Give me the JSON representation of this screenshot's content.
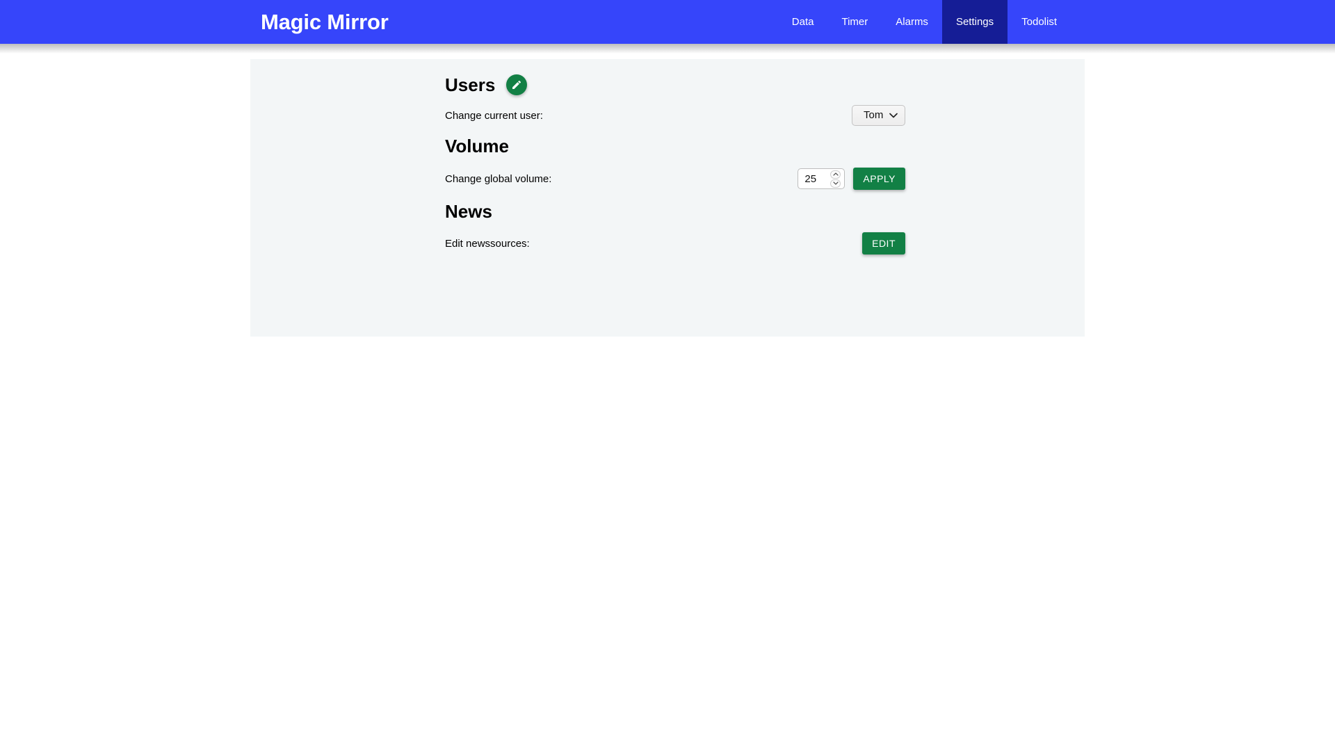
{
  "navbar": {
    "brand": "Magic Mirror",
    "brand_color": "#3645fa",
    "active_color": "#151d96",
    "items": [
      {
        "label": "Data",
        "active": false
      },
      {
        "label": "Timer",
        "active": false
      },
      {
        "label": "Alarms",
        "active": false
      },
      {
        "label": "Settings",
        "active": true
      },
      {
        "label": "Todolist",
        "active": false
      }
    ]
  },
  "panel": {
    "background": "#f3f6f7",
    "accent_green": "#128045",
    "sections": {
      "users": {
        "title": "Users",
        "edit_icon": "pencil-icon",
        "row_label": "Change current user:",
        "select_value": "Tom",
        "select_options": [
          "Tom"
        ]
      },
      "volume": {
        "title": "Volume",
        "row_label": "Change global volume:",
        "value": "25",
        "apply_label": "APPLY"
      },
      "news": {
        "title": "News",
        "row_label": "Edit newssources:",
        "edit_label": "EDIT"
      }
    }
  }
}
